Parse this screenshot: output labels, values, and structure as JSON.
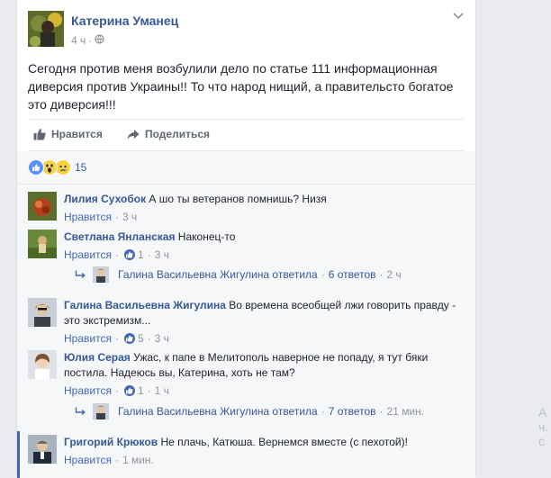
{
  "post": {
    "author": "Катерина Уманец",
    "time": "4 ч",
    "text": "Сегодня против меня возбулили дело по статье 111 информационная диверсия против Украины!! То что народ нищий, а правительсто богатое это диверсия!!!",
    "like_label": "Нравится",
    "share_label": "Поделиться",
    "reactions_count": "15"
  },
  "comments": [
    {
      "author": "Лилия Сухобок",
      "text": "А шо ты ветеранов помнишь? Низя",
      "like": "Нравится",
      "likes": "",
      "time": "3 ч"
    },
    {
      "author": "Светлана Янланская",
      "text": "Наконец-то",
      "like": "Нравится",
      "likes": "1",
      "time": "3 ч"
    },
    {
      "author": "Галина Васильевна Жигулина",
      "text": "Во времена всеобщей лжи говорить правду - это экстремизм...",
      "like": "Нравится",
      "likes": "5",
      "time": "3 ч"
    },
    {
      "author": "Юлия Серая",
      "text": "Ужас, к папе в Мелитополь наверное не попаду, я тут бяки постила. Надеюсь вы, Катерина, хоть не там?",
      "like": "Нравится",
      "likes": "1",
      "time": "1 ч"
    },
    {
      "author": "Григорий Крюков",
      "text": "Не плачь, Катюша. Вернемся вместе (с пехотой)!",
      "like": "Нравится",
      "likes": "",
      "time": "1 мин."
    }
  ],
  "replies": [
    {
      "who": "Галина Васильевна Жигулина",
      "replied": "ответила",
      "count": "6 ответов",
      "time": "2 ч"
    },
    {
      "who": "Галина Васильевна Жигулина",
      "replied": "ответила",
      "count": "7 ответов",
      "time": "21 мин."
    }
  ],
  "sep": "·",
  "right_fragment": "А ч. с"
}
